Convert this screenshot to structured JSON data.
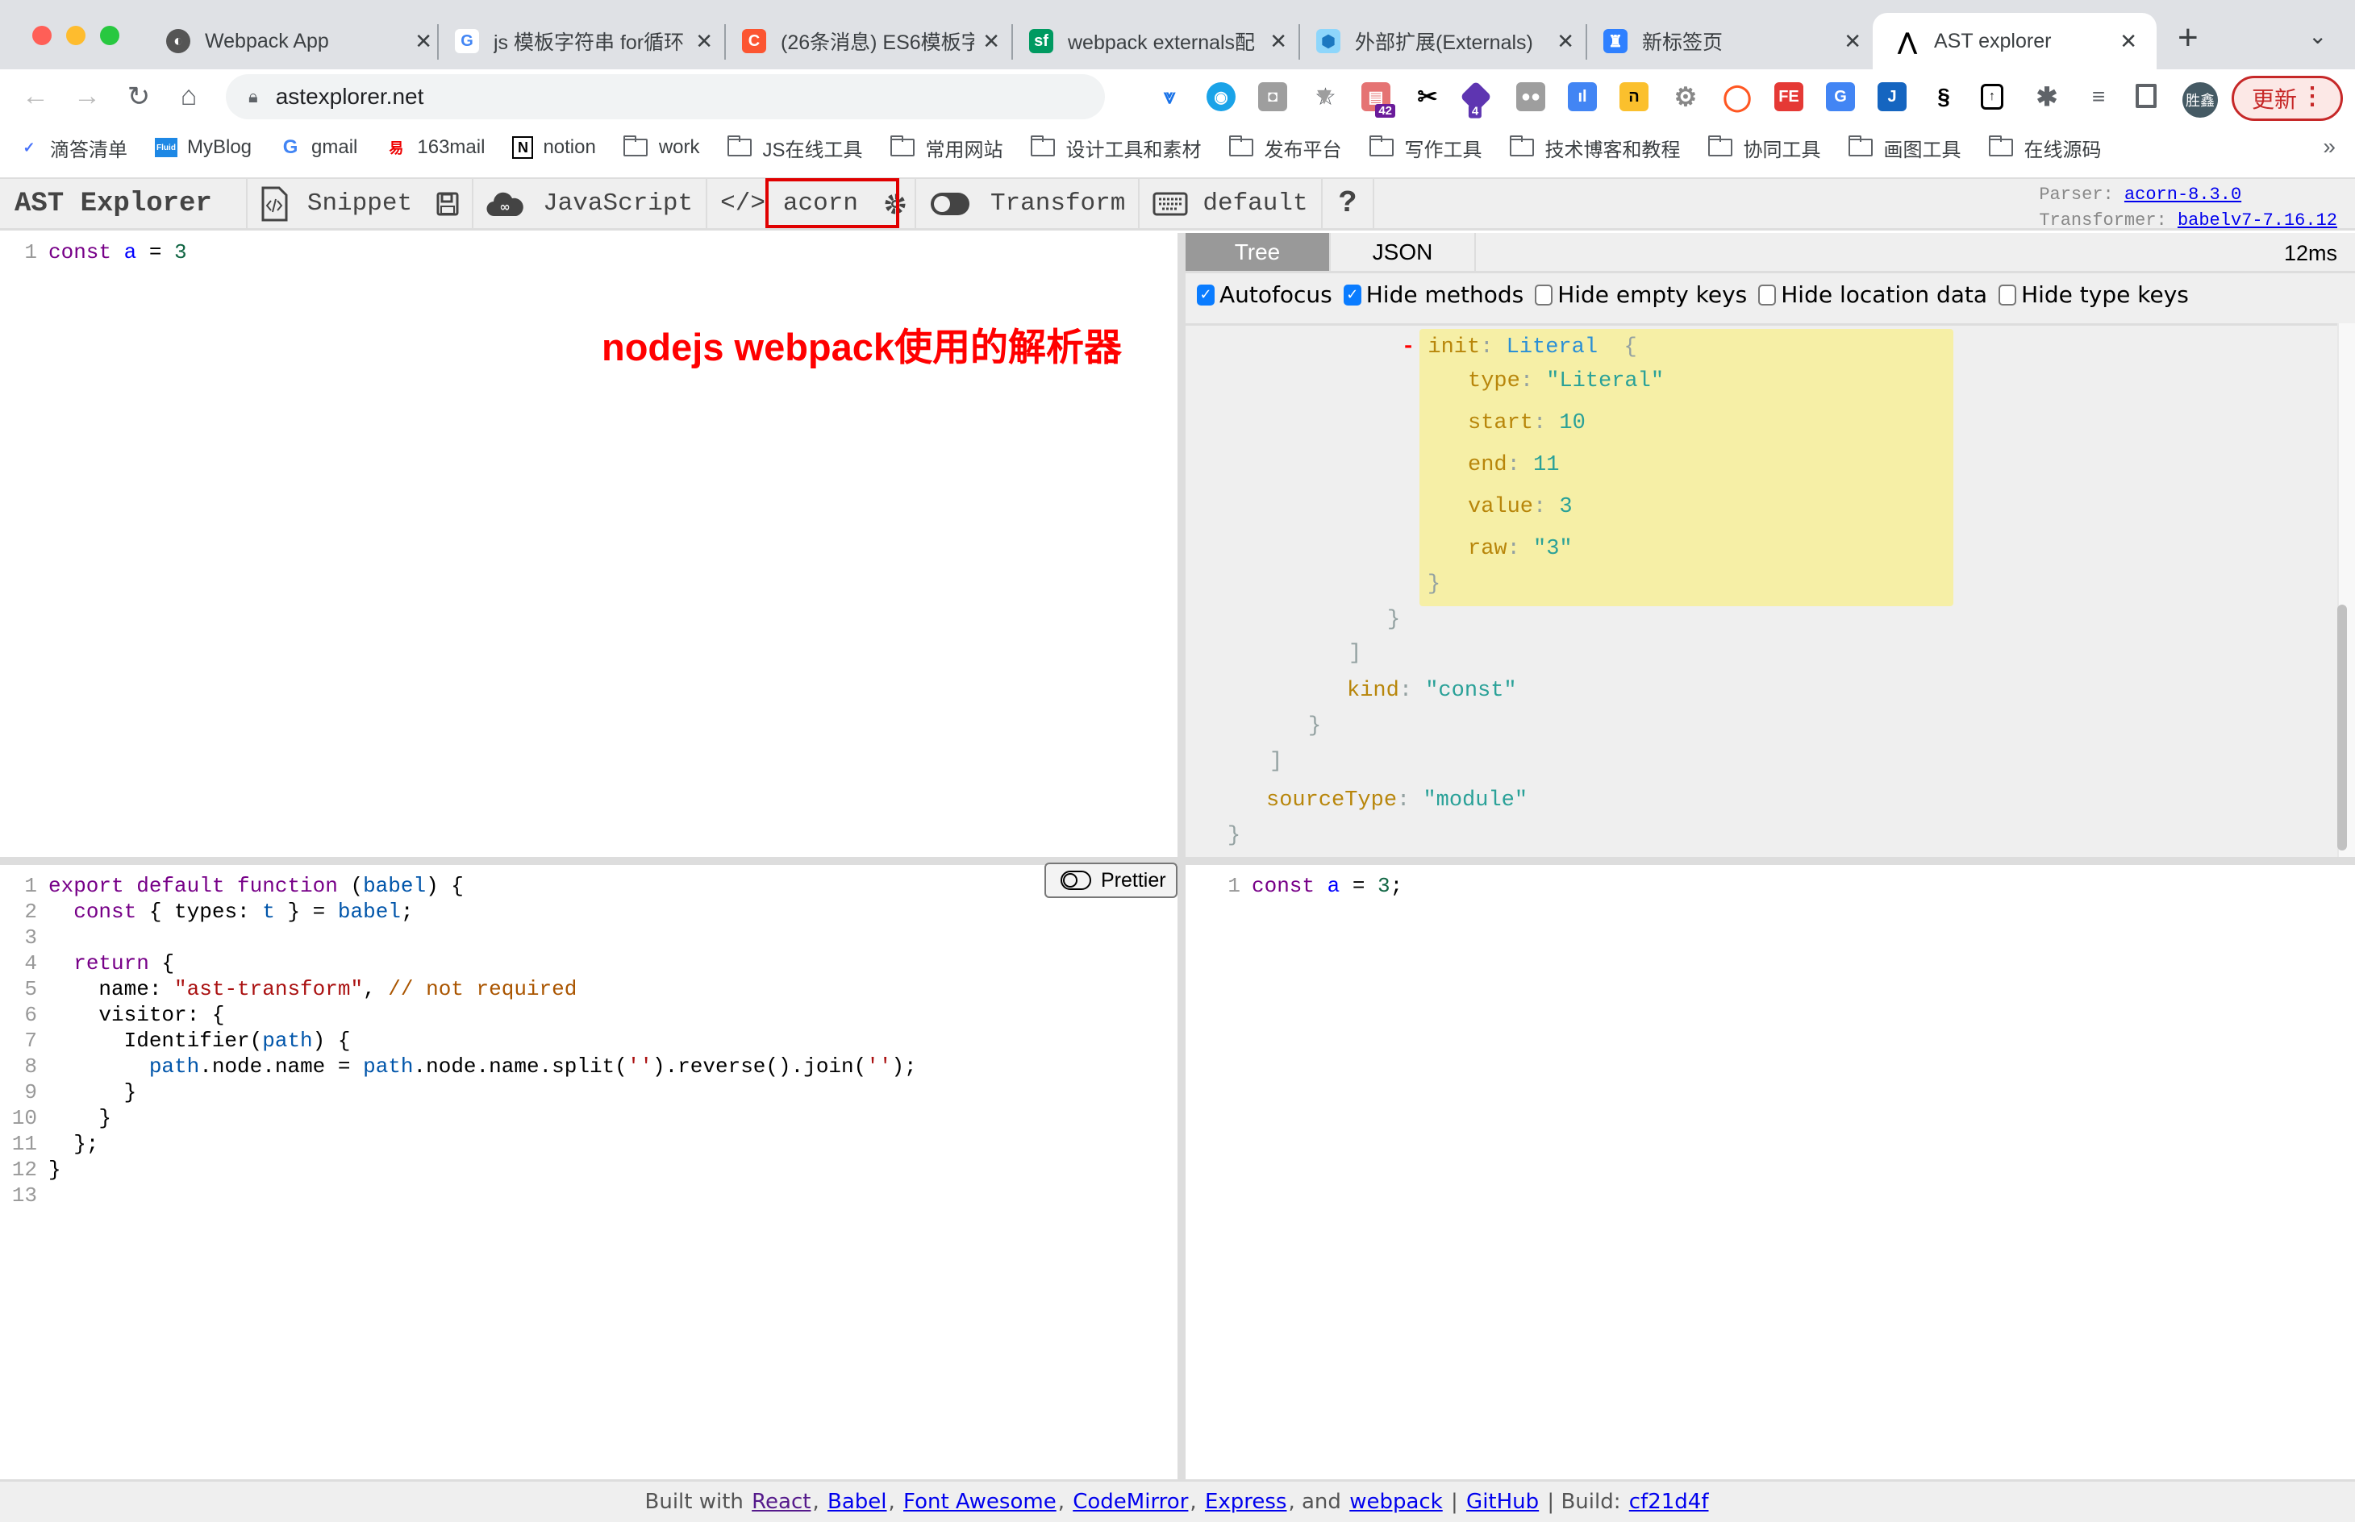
{
  "browser": {
    "tabs": [
      {
        "title": "Webpack App",
        "icon": "globe-icon",
        "active": false
      },
      {
        "title": "js 模板字符串 for循环",
        "icon": "google-icon",
        "active": false
      },
      {
        "title": "(26条消息) ES6模板字",
        "icon": "csdn-icon",
        "active": false
      },
      {
        "title": "webpack externals配",
        "icon": "segmentfault-icon",
        "active": false
      },
      {
        "title": "外部扩展(Externals)",
        "icon": "webpack-icon",
        "active": false
      },
      {
        "title": "新标签页",
        "icon": "newtab-icon",
        "active": false
      },
      {
        "title": "AST explorer",
        "icon": "astexplorer-icon",
        "active": true
      }
    ],
    "new_tab_label": "+",
    "tab_list_label": "⌄",
    "url": "astexplorer.net",
    "profile_initials": "胜鑫",
    "update_label": "更新",
    "extension_badges": {
      "ext5": "42",
      "ext7": "4"
    },
    "bookmarks": [
      {
        "label": "滴答清单",
        "type": "site"
      },
      {
        "label": "MyBlog",
        "type": "site"
      },
      {
        "label": "gmail",
        "type": "site"
      },
      {
        "label": "163mail",
        "type": "site"
      },
      {
        "label": "notion",
        "type": "site"
      },
      {
        "label": "work",
        "type": "folder"
      },
      {
        "label": "JS在线工具",
        "type": "folder"
      },
      {
        "label": "常用网站",
        "type": "folder"
      },
      {
        "label": "设计工具和素材",
        "type": "folder"
      },
      {
        "label": "发布平台",
        "type": "folder"
      },
      {
        "label": "写作工具",
        "type": "folder"
      },
      {
        "label": "技术博客和教程",
        "type": "folder"
      },
      {
        "label": "协同工具",
        "type": "folder"
      },
      {
        "label": "画图工具",
        "type": "folder"
      },
      {
        "label": "在线源码",
        "type": "folder"
      }
    ],
    "bookmarks_more": "»"
  },
  "toolbar": {
    "brand": "AST Explorer",
    "snippet": "Snippet",
    "language": "JavaScript",
    "parser": "acorn",
    "transform": "Transform",
    "keymap": "default",
    "help": "?",
    "parser_label": "Parser:",
    "parser_version": "acorn-8.3.0",
    "transformer_label": "Transformer:",
    "transformer_version": "babelv7-7.16.12"
  },
  "annotation": "nodejs webpack使用的解析器",
  "source_editor": {
    "lines": [
      {
        "n": "1",
        "tokens": [
          [
            "kw",
            "const"
          ],
          [
            "pl",
            " "
          ],
          [
            "var",
            "a"
          ],
          [
            "pl",
            " = "
          ],
          [
            "num",
            "3"
          ]
        ]
      }
    ]
  },
  "output": {
    "tabs": [
      "Tree",
      "JSON"
    ],
    "active_tab": "Tree",
    "time": "12ms",
    "options": [
      {
        "label": "Autofocus",
        "checked": true
      },
      {
        "label": "Hide methods",
        "checked": true
      },
      {
        "label": "Hide empty keys",
        "checked": false
      },
      {
        "label": "Hide location data",
        "checked": false
      },
      {
        "label": "Hide type keys",
        "checked": false
      }
    ],
    "tree": {
      "collapse_marker": "-",
      "init_key": "init",
      "init_type": "Literal",
      "open_brace": "{",
      "props": [
        {
          "key": "type",
          "value": "\"Literal\""
        },
        {
          "key": "start",
          "value": "10"
        },
        {
          "key": "end",
          "value": "11"
        },
        {
          "key": "value",
          "value": "3"
        },
        {
          "key": "raw",
          "value": "\"3\""
        }
      ],
      "close_brace": "}",
      "close_brace2": "}",
      "close_bracket": "]",
      "kind_key": "kind",
      "kind_value": "\"const\"",
      "close_brace3": "}",
      "close_bracket2": "]",
      "sourcetype_key": "sourceType",
      "sourcetype_value": "\"module\"",
      "close_root": "}"
    }
  },
  "transform_editor": {
    "prettier_label": "Prettier",
    "lines": [
      {
        "n": "1",
        "tokens": [
          [
            "kw",
            "export default function"
          ],
          [
            "pl",
            " ("
          ],
          [
            "def",
            "babel"
          ],
          [
            "pl",
            ") {"
          ]
        ]
      },
      {
        "n": "2",
        "tokens": [
          [
            "pl",
            "  "
          ],
          [
            "kw",
            "const"
          ],
          [
            "pl",
            " { types: "
          ],
          [
            "def",
            "t"
          ],
          [
            "pl",
            " } = "
          ],
          [
            "def",
            "babel"
          ],
          [
            "pl",
            ";"
          ]
        ]
      },
      {
        "n": "3",
        "tokens": []
      },
      {
        "n": "4",
        "tokens": [
          [
            "pl",
            "  "
          ],
          [
            "kw",
            "return"
          ],
          [
            "pl",
            " {"
          ]
        ]
      },
      {
        "n": "5",
        "tokens": [
          [
            "pl",
            "    name: "
          ],
          [
            "str",
            "\"ast-transform\""
          ],
          [
            "pl",
            ", "
          ],
          [
            "cmt",
            "// not required"
          ]
        ]
      },
      {
        "n": "6",
        "tokens": [
          [
            "pl",
            "    visitor: {"
          ]
        ]
      },
      {
        "n": "7",
        "tokens": [
          [
            "pl",
            "      Identifier("
          ],
          [
            "def",
            "path"
          ],
          [
            "pl",
            ") {"
          ]
        ]
      },
      {
        "n": "8",
        "tokens": [
          [
            "pl",
            "        "
          ],
          [
            "def",
            "path"
          ],
          [
            "pl",
            ".node.name = "
          ],
          [
            "def",
            "path"
          ],
          [
            "pl",
            ".node.name.split("
          ],
          [
            "str",
            "''"
          ],
          [
            "pl",
            ").reverse().join("
          ],
          [
            "str",
            "''"
          ],
          [
            "pl",
            ");"
          ]
        ]
      },
      {
        "n": "9",
        "tokens": [
          [
            "pl",
            "      }"
          ]
        ]
      },
      {
        "n": "10",
        "tokens": [
          [
            "pl",
            "    }"
          ]
        ]
      },
      {
        "n": "11",
        "tokens": [
          [
            "pl",
            "  };"
          ]
        ]
      },
      {
        "n": "12",
        "tokens": [
          [
            "pl",
            "}"
          ]
        ]
      },
      {
        "n": "13",
        "tokens": []
      }
    ]
  },
  "transform_output": {
    "lines": [
      {
        "n": "1",
        "tokens": [
          [
            "kw",
            "const"
          ],
          [
            "pl",
            " "
          ],
          [
            "var",
            "a"
          ],
          [
            "pl",
            " = "
          ],
          [
            "num",
            "3"
          ],
          [
            "pl",
            ";"
          ]
        ]
      }
    ]
  },
  "footer": {
    "built_with": "Built with",
    "react": "React",
    "babel": "Babel",
    "font_awesome": "Font Awesome",
    "codemirror": "CodeMirror",
    "express": "Express",
    "and": ", and",
    "webpack": "webpack",
    "sep": "|",
    "github": "GitHub",
    "build_label": "Build:",
    "build_hash": "cf21d4f"
  }
}
